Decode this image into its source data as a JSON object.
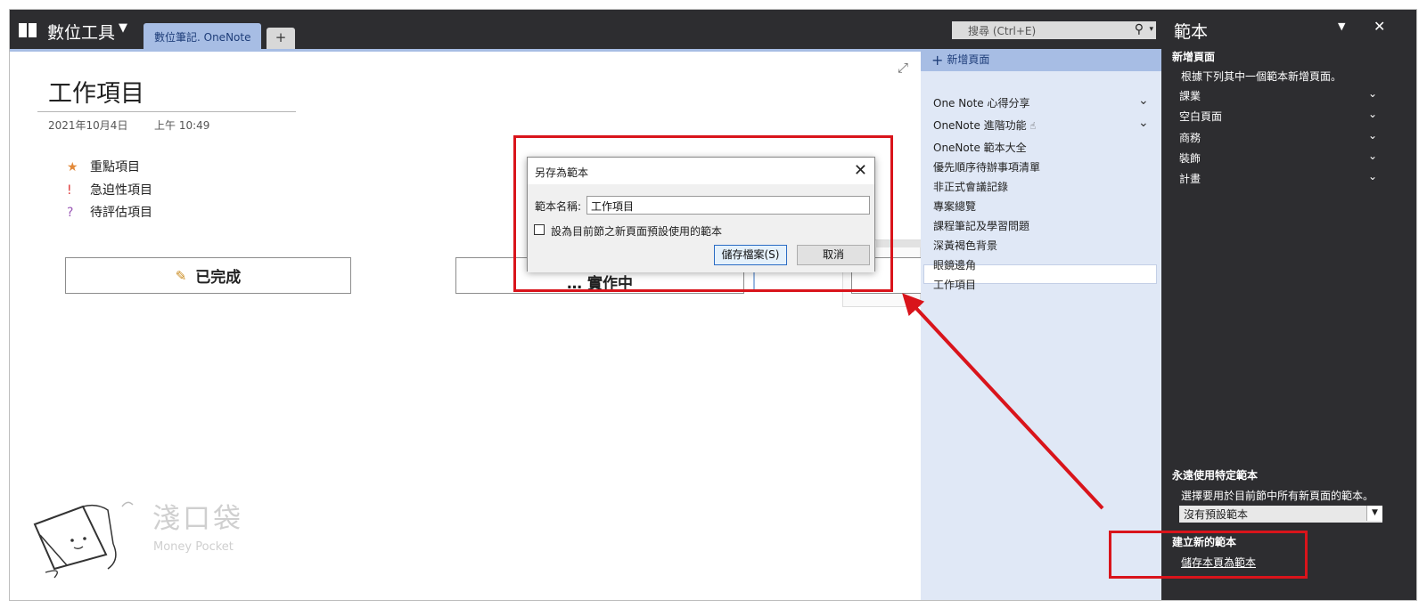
{
  "topbar": {
    "notebook_name": "數位工具",
    "notebook_caret": "▼",
    "section_tab": "數位筆記. OneNote",
    "add_tab": "+",
    "search_placeholder": "搜尋 (Ctrl+E)"
  },
  "page": {
    "title": "工作項目",
    "date": "2021年10月4日",
    "time": "上午 10:49",
    "tags": [
      {
        "symbol": "★",
        "label": "重點項目"
      },
      {
        "symbol": "!",
        "label": "急迫性項目"
      },
      {
        "symbol": "?",
        "label": "待評估項目"
      }
    ],
    "buttons": {
      "done_label": "已完成",
      "in_progress_label": "… 實作中"
    }
  },
  "dialog": {
    "title": "另存為範本",
    "close": "✕",
    "name_label": "範本名稱:",
    "name_value": "工作項目",
    "checkbox_label": "設為目前節之新頁面預設使用的範本",
    "save_button": "儲存檔案(S)",
    "cancel_button": "取消"
  },
  "page_list": {
    "add_page": "新增頁面",
    "items": [
      "One Note 心得分享",
      "OneNote 進階功能",
      "OneNote 範本大全",
      "優先順序待辦事項清單",
      "非正式會議記錄",
      "專案總覽",
      "課程筆記及學習問題",
      "深黃褐色背景",
      "眼鏡邊角",
      "工作項目"
    ],
    "selected_index": 9
  },
  "templates_pane": {
    "title": "範本",
    "new_page_heading": "新增頁面",
    "new_page_desc": "根據下列其中一個範本新增頁面。",
    "categories": [
      "課業",
      "空白頁面",
      "商務",
      "裝飾",
      "計畫"
    ],
    "always_use_heading": "永遠使用特定範本",
    "always_use_desc": "選擇要用於目前節中所有新頁面的範本。",
    "default_template_value": "沒有預設範本",
    "create_heading": "建立新的範本",
    "save_as_template_link": "儲存本頁為範本"
  },
  "watermark": {
    "brand_cn": "淺口袋",
    "brand_en": "Money Pocket"
  },
  "colors": {
    "accent_red": "#d9141b",
    "tab_blue": "#a7bde4",
    "list_bg": "#e0e8f6",
    "dark_bar": "#2d2d30"
  }
}
